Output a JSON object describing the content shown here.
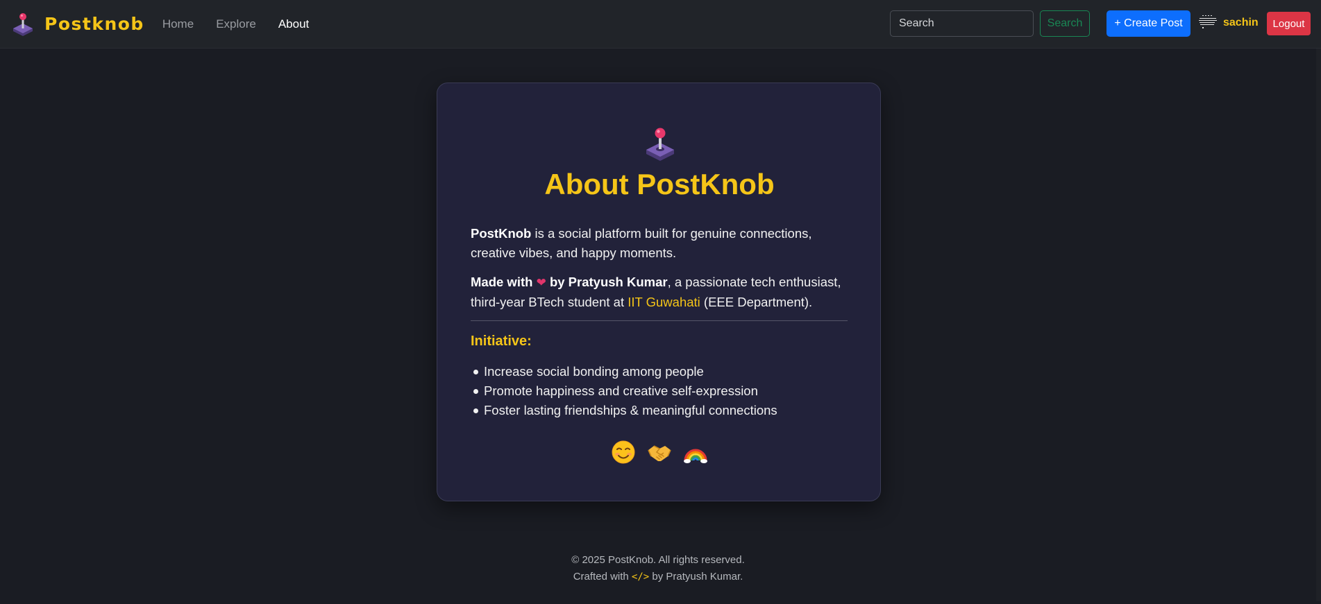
{
  "nav": {
    "brand": "Postknob",
    "links": [
      {
        "label": "Home",
        "active": false
      },
      {
        "label": "Explore",
        "active": false
      },
      {
        "label": "About",
        "active": true
      }
    ],
    "search_placeholder": "Search",
    "search_button": "Search",
    "create_button": "+ Create Post",
    "username": "sachin",
    "logout_button": "Logout"
  },
  "about": {
    "title": "About PostKnob",
    "p1_bold": "PostKnob",
    "p1_rest": " is a social platform built for genuine connections, creative vibes, and happy moments.",
    "p2_bold_a": "Made with",
    "heart": "❤",
    "p2_bold_b": "by Pratyush Kumar",
    "p2_mid": ", a passionate tech enthusiast, third-year BTech student at ",
    "p2_link": "IIT Guwahati",
    "p2_end": " (EEE Department).",
    "initiative_heading": "Initiative:",
    "initiatives": [
      "Increase social bonding among people",
      "Promote happiness and creative self-expression",
      "Foster lasting friendships & meaningful connections"
    ],
    "emoji_icons": [
      "smiling-face-icon",
      "handshake-icon",
      "rainbow-icon"
    ]
  },
  "footer": {
    "line1": "© 2025 PostKnob. All rights reserved.",
    "line2_a": "Crafted with ",
    "line2_code": "</>",
    "line2_b": " by Pratyush Kumar."
  },
  "colors": {
    "accent": "#f5c518",
    "background": "#1a1c23",
    "card": "#22223a",
    "create_button": "#0d6efd",
    "logout_button": "#dc3545",
    "search_button": "#198754"
  }
}
